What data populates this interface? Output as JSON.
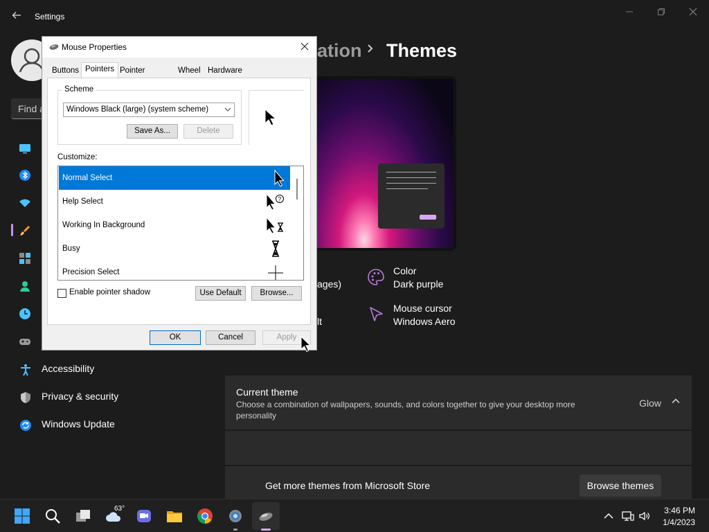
{
  "app": {
    "title": "Settings",
    "search_placeholder": "Find a",
    "breadcrumb_tail": "ation",
    "page_title": "Themes"
  },
  "nav": {
    "items": [
      {
        "label": "Accessibility",
        "icon": "accessibility-icon"
      },
      {
        "label": "Privacy & security",
        "icon": "shield-icon"
      },
      {
        "label": "Windows Update",
        "icon": "windows-update-icon"
      }
    ]
  },
  "theme_settings": {
    "cut_text_1": "ages)",
    "cut_text_2": "lt",
    "color_label": "Color",
    "color_value": "Dark purple",
    "cursor_label": "Mouse cursor",
    "cursor_value": "Windows Aero"
  },
  "current_theme": {
    "title": "Current theme",
    "subtitle": "Choose a combination of wallpapers, sounds, and colors together to give your desktop more personality",
    "value": "Glow"
  },
  "store": {
    "text": "Get more themes from Microsoft Store",
    "button": "Browse themes"
  },
  "dialog": {
    "title": "Mouse Properties",
    "tabs": [
      "Buttons",
      "Pointers",
      "Pointer Options",
      "Wheel",
      "Hardware"
    ],
    "active_tab": "Pointers",
    "scheme_label": "Scheme",
    "scheme_value": "Windows Black (large) (system scheme)",
    "save_as": "Save As...",
    "delete": "Delete",
    "customize_label": "Customize:",
    "pointers": [
      {
        "name": "Normal Select",
        "icon": "arrow-cursor-icon",
        "selected": true
      },
      {
        "name": "Help Select",
        "icon": "help-cursor-icon",
        "selected": false
      },
      {
        "name": "Working In Background",
        "icon": "working-cursor-icon",
        "selected": false
      },
      {
        "name": "Busy",
        "icon": "busy-hourglass-icon",
        "selected": false
      },
      {
        "name": "Precision Select",
        "icon": "crosshair-icon",
        "selected": false
      }
    ],
    "shadow_label": "Enable pointer shadow",
    "shadow_checked": false,
    "use_default": "Use Default",
    "browse": "Browse...",
    "ok": "OK",
    "cancel": "Cancel",
    "apply": "Apply"
  },
  "taskbar": {
    "temperature": "63°",
    "time": "3:46 PM",
    "date": "1/4/2023"
  },
  "colors": {
    "accent": "#c792ea",
    "selection_blue": "#0078d7",
    "settings_bg": "#1c1c1c",
    "card_bg": "#2b2b2b"
  }
}
